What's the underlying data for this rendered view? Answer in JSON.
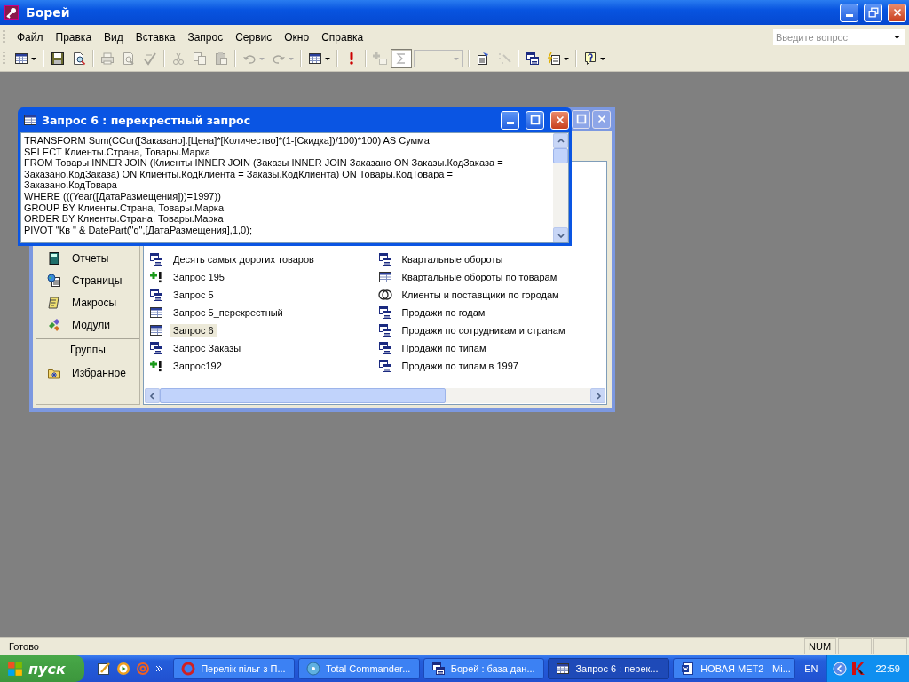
{
  "app": {
    "title": "Борей"
  },
  "menu": [
    "Файл",
    "Правка",
    "Вид",
    "Вставка",
    "Запрос",
    "Сервис",
    "Окно",
    "Справка"
  ],
  "help_search": {
    "placeholder": "Введите вопрос"
  },
  "toolbar": [
    [
      {
        "kind": "button",
        "disabled": false,
        "pressed": false,
        "dropdown": true
      }
    ],
    [
      {
        "kind": "button",
        "disabled": false,
        "pressed": false,
        "dropdown": false
      },
      {
        "kind": "button",
        "disabled": false,
        "pressed": false,
        "dropdown": false
      }
    ],
    [
      {
        "kind": "button",
        "disabled": true,
        "pressed": false,
        "dropdown": false
      },
      {
        "kind": "button",
        "disabled": true,
        "pressed": false,
        "dropdown": false
      },
      {
        "kind": "button",
        "disabled": true,
        "pressed": false,
        "dropdown": false
      }
    ],
    [
      {
        "kind": "button",
        "disabled": true,
        "pressed": false,
        "dropdown": false
      },
      {
        "kind": "button",
        "disabled": true,
        "pressed": false,
        "dropdown": false
      },
      {
        "kind": "button",
        "disabled": true,
        "pressed": false,
        "dropdown": false
      }
    ],
    [
      {
        "kind": "button",
        "disabled": true,
        "pressed": false,
        "dropdown": true
      },
      {
        "kind": "button",
        "disabled": true,
        "pressed": false,
        "dropdown": true
      }
    ],
    [
      {
        "kind": "button",
        "disabled": false,
        "pressed": false,
        "dropdown": true
      }
    ],
    [
      {
        "kind": "button",
        "disabled": false,
        "pressed": false,
        "dropdown": false
      }
    ],
    [
      {
        "kind": "button",
        "disabled": true,
        "pressed": false,
        "dropdown": false
      },
      {
        "kind": "button",
        "disabled": true,
        "pressed": true,
        "dropdown": false
      },
      {
        "kind": "combo",
        "disabled": true,
        "dropdown": true
      }
    ],
    [
      {
        "kind": "button",
        "disabled": false,
        "pressed": false,
        "dropdown": false
      },
      {
        "kind": "button",
        "disabled": true,
        "pressed": false,
        "dropdown": false
      }
    ],
    [
      {
        "kind": "button",
        "disabled": false,
        "pressed": false,
        "dropdown": false
      },
      {
        "kind": "button",
        "disabled": false,
        "pressed": false,
        "dropdown": true
      }
    ],
    [
      {
        "kind": "button",
        "disabled": false,
        "pressed": false,
        "dropdown": true
      }
    ]
  ],
  "database_window": {
    "objects": [
      {
        "label": "Отчеты",
        "kind": "report",
        "selected": false
      },
      {
        "label": "Страницы",
        "kind": "page",
        "selected": false
      },
      {
        "label": "Макросы",
        "kind": "macro",
        "selected": false
      },
      {
        "label": "Модули",
        "kind": "module",
        "selected": false
      }
    ],
    "groups_header": "Группы",
    "groups": [
      {
        "label": "Избранное",
        "kind": "favorites",
        "selected": false
      }
    ],
    "columns": [
      [
        {
          "label": "Десять самых дорогих товаров",
          "kind": "select",
          "selected": false
        },
        {
          "label": "Запрос 195",
          "kind": "append",
          "selected": false
        },
        {
          "label": "Запрос 5",
          "kind": "select",
          "selected": false
        },
        {
          "label": "Запрос 5_перекрестный",
          "kind": "crosstab",
          "selected": false
        },
        {
          "label": "Запрос 6",
          "kind": "crosstab",
          "selected": true
        },
        {
          "label": "Запрос Заказы",
          "kind": "select",
          "selected": false
        },
        {
          "label": "Запрос192",
          "kind": "append",
          "selected": false
        }
      ],
      [
        {
          "label": "Квартальные обороты",
          "kind": "select",
          "selected": false
        },
        {
          "label": "Квартальные обороты по товарам",
          "kind": "crosstab",
          "selected": false
        },
        {
          "label": "Клиенты и поставщики по городам",
          "kind": "union",
          "selected": false
        },
        {
          "label": "Продажи по годам",
          "kind": "select",
          "selected": false
        },
        {
          "label": "Продажи по сотрудникам и странам",
          "kind": "select",
          "selected": false
        },
        {
          "label": "Продажи по типам",
          "kind": "select",
          "selected": false
        },
        {
          "label": "Продажи по типам в 1997",
          "kind": "select",
          "selected": false
        }
      ]
    ]
  },
  "query_window": {
    "title": "Запрос 6 : перекрестный запрос",
    "sql_lines": [
      "TRANSFORM Sum(CCur([Заказано].[Цена]*[Количество]*(1-[Скидка])/100)*100) AS Сумма",
      "SELECT Клиенты.Страна, Товары.Марка",
      "FROM Товары INNER JOIN (Клиенты INNER JOIN (Заказы INNER JOIN Заказано ON Заказы.КодЗаказа =",
      "Заказано.КодЗаказа) ON Клиенты.КодКлиента = Заказы.КодКлиента) ON Товары.КодТовара =",
      "Заказано.КодТовара",
      "WHERE (((Year([ДатаРазмещения]))=1997))",
      "GROUP BY Клиенты.Страна, Товары.Марка",
      "ORDER BY Клиенты.Страна, Товары.Марка",
      "PIVOT \"Кв \" & DatePart(\"q\",[ДатаРазмещения],1,0);"
    ]
  },
  "status_bar": {
    "message": "Готово",
    "indicator": "NUM"
  },
  "taskbar": {
    "start": "пуск",
    "tasks": [
      {
        "label": "Перелік пільг з П...",
        "kind": "browser",
        "selected": false
      },
      {
        "label": "Total Commander...",
        "kind": "filemanager",
        "selected": false
      },
      {
        "label": "Борей : база дан...",
        "kind": "database",
        "selected": false
      },
      {
        "label": "Запрос 6 : перек...",
        "kind": "query",
        "selected": true
      },
      {
        "label": "НОВАЯ МЕТ2 - Mi...",
        "kind": "document",
        "selected": false
      }
    ],
    "language": "EN",
    "clock": "22:59"
  }
}
